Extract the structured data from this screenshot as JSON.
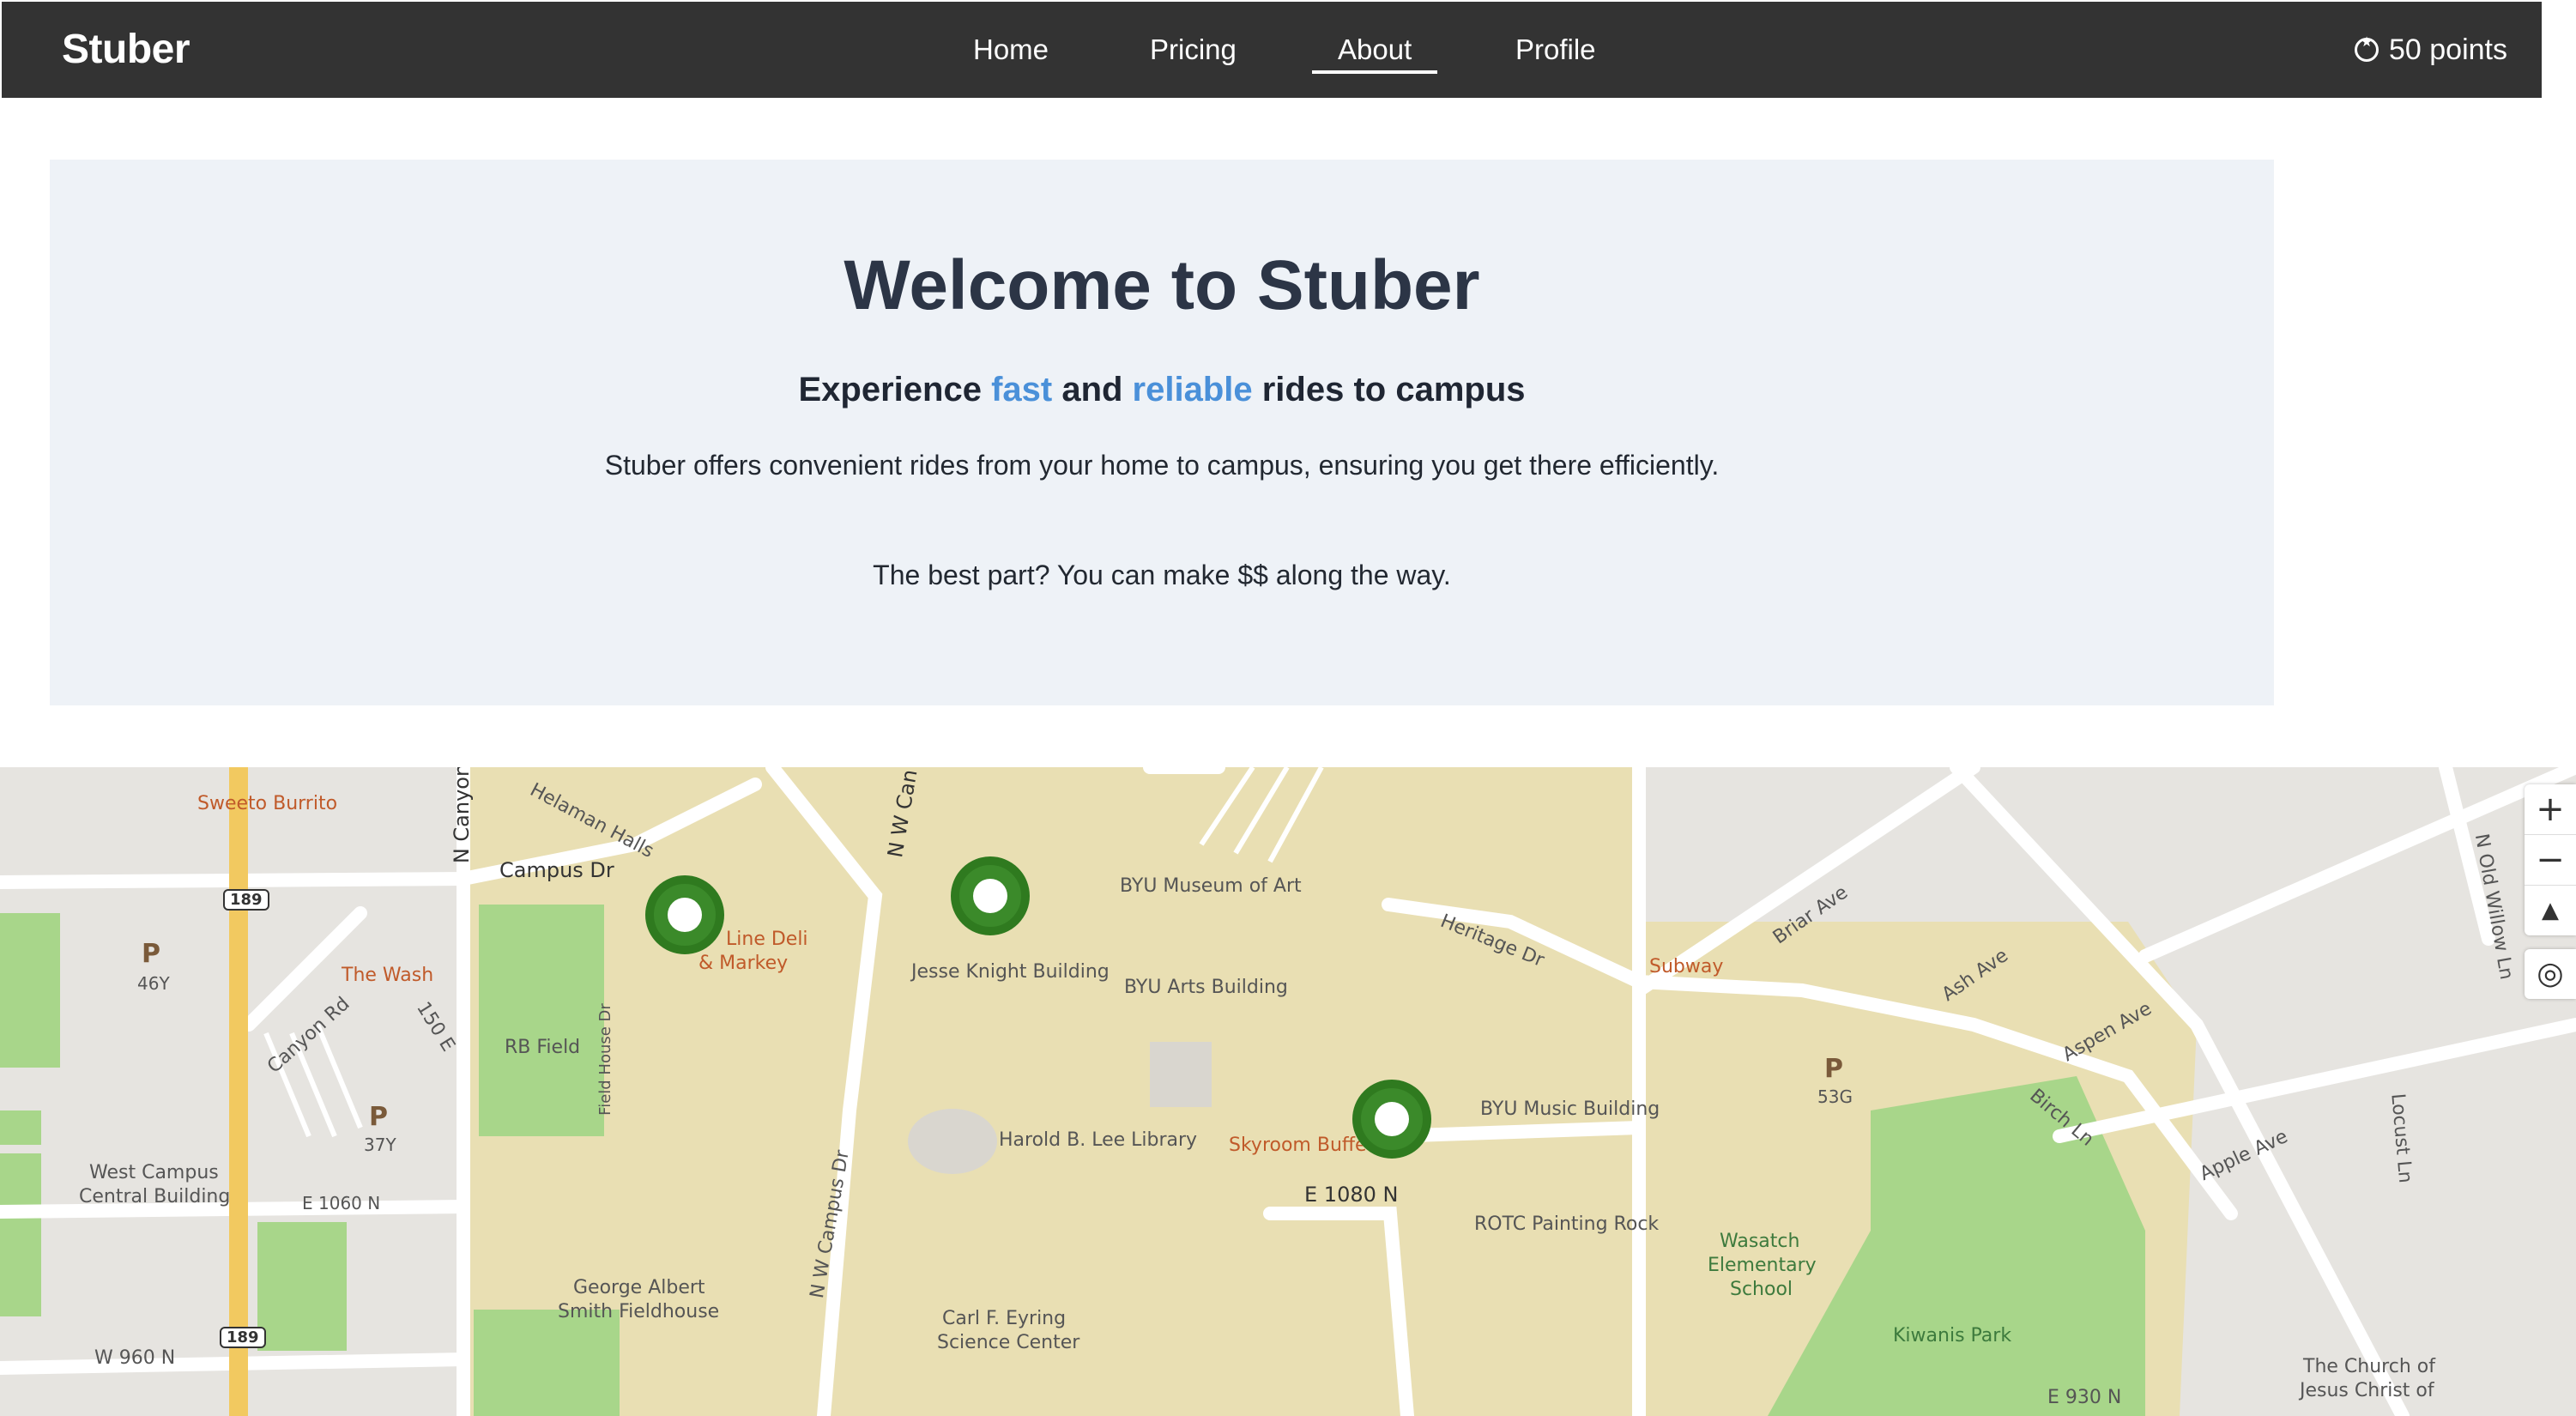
{
  "brand": "Stuber",
  "nav": {
    "items": [
      {
        "label": "Home",
        "active": false
      },
      {
        "label": "Pricing",
        "active": false
      },
      {
        "label": "About",
        "active": true
      },
      {
        "label": "Profile",
        "active": false
      }
    ],
    "points": "50 points",
    "points_icon": "star-circle-icon"
  },
  "hero": {
    "title": "Welcome to Stuber",
    "subtitle": {
      "pre": "Experience ",
      "hl1": "fast",
      "mid": " and ",
      "hl2": "reliable",
      "post": " rides to campus"
    },
    "p1": "Stuber offers convenient rides from your home to campus, ensuring you get there efficiently.",
    "p2": "The best part? You can make $$ along the way.",
    "accent": "#4a90d9"
  },
  "map": {
    "controls": {
      "zoom_in": "+",
      "zoom_out": "−",
      "compass": "▲",
      "locate": "◎"
    },
    "labels": {
      "sweeto": "Sweeto Burrito",
      "campus_dr": "Campus Dr",
      "helaman": "Helaman Halls",
      "n_canyon": "N Canyon",
      "nw_can": "N W Can",
      "museum": "BYU Museum of Art",
      "heritage": "Heritage Dr",
      "subway": "Subway",
      "briar": "Briar Ave",
      "ash": "Ash Ave",
      "aspen": "Aspen Ave",
      "old_willow": "N Old Willow Ln",
      "p46": "P",
      "p46_sub": "46Y",
      "the_wash": "The Wash",
      "line_deli": "Line Deli",
      "markey": "& Markey",
      "jesse": "Jesse Knight Building",
      "arts": "BYU Arts Building",
      "canyon_rd": "Canyon Rd",
      "e150": "150 E",
      "rb_field": "RB Field",
      "field_house": "Field House Dr",
      "p37": "P",
      "p37_sub": "37Y",
      "library": "Harold B. Lee Library",
      "skyroom": "Skyroom Buffet",
      "music": "BYU Music Building",
      "p53": "P",
      "p53_sub": "53G",
      "birch": "Birch Ln",
      "apple": "Apple Ave",
      "locust": "Locust Ln",
      "west_campus": "West Campus",
      "central_bldg": "Central Building",
      "e1060": "E 1060 N",
      "nw_campus": "N W Campus Dr",
      "e1080": "E 1080 N",
      "rotc": "ROTC Painting Rock",
      "wasatch": "Wasatch",
      "elementary": "Elementary",
      "school": "School",
      "george": "George Albert",
      "smith": "Smith Fieldhouse",
      "carl": "Carl F. Eyring",
      "science": "Science Center",
      "kiwanis": "Kiwanis Park",
      "w960": "W 960 N",
      "church1": "The Church of",
      "church2": "Jesus Christ of",
      "e930": "E 930 N",
      "hwy": "189"
    }
  }
}
